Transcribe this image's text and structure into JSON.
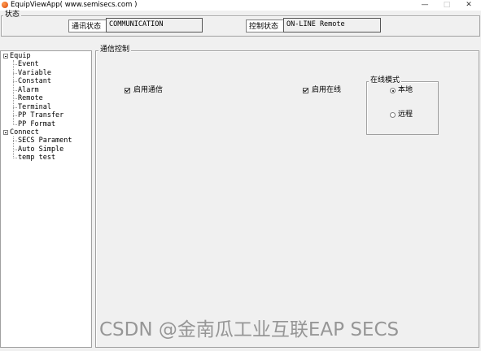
{
  "window": {
    "title": "EquipViewApp( www.semisecs.com )",
    "controls": {
      "minimize": "—",
      "maximize": "□",
      "close": "✕"
    }
  },
  "status_group": {
    "legend": "状态",
    "comm_label": "通讯状态",
    "comm_value": "COMMUNICATION",
    "control_label": "控制状态",
    "control_value": "ON-LINE Remote"
  },
  "tree": {
    "roots": [
      {
        "label": "Equip",
        "children": [
          "Event",
          "Variable",
          "Constant",
          "Alarm",
          "Remote",
          "Terminal",
          "PP Transfer",
          "PP Format"
        ]
      },
      {
        "label": "Connect",
        "children": [
          "SECS Parament",
          "Auto Simple",
          "temp test"
        ]
      }
    ]
  },
  "comm_control": {
    "legend": "通信控制",
    "enable_comm": {
      "label": "启用通信",
      "checked": true
    },
    "enable_online": {
      "label": "启用在线",
      "checked": true
    },
    "online_mode": {
      "legend": "在线模式",
      "options": [
        {
          "label": "本地",
          "selected": true
        },
        {
          "label": "远程",
          "selected": false
        }
      ]
    }
  },
  "watermark": "CSDN @金南瓜工业互联EAP SECS",
  "icons": {
    "app": "app-icon",
    "expander": "collapse-icon"
  }
}
